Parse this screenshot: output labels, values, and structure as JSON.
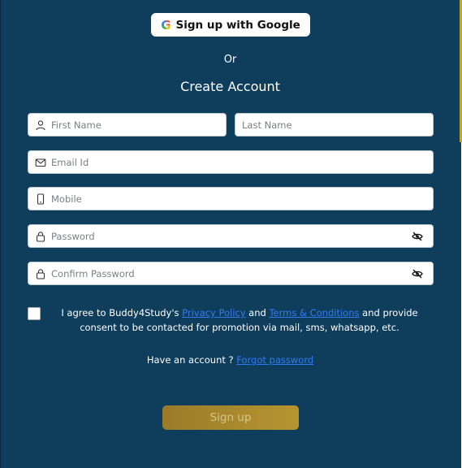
{
  "google": {
    "label": "Sign up with Google"
  },
  "divider": {
    "or": "Or"
  },
  "form": {
    "title": "Create Account",
    "first_name": {
      "placeholder": "First Name",
      "value": ""
    },
    "last_name": {
      "placeholder": "Last Name",
      "value": ""
    },
    "email": {
      "placeholder": "Email Id",
      "value": ""
    },
    "mobile": {
      "placeholder": "Mobile",
      "value": ""
    },
    "password": {
      "placeholder": "Password",
      "value": ""
    },
    "confirm_password": {
      "placeholder": "Confirm Password",
      "value": ""
    }
  },
  "consent": {
    "prefix": "I agree to Buddy4Study's ",
    "privacy_link": "Privacy Policy",
    "and": " and ",
    "terms_link": "Terms & Conditions",
    "suffix": " and provide consent to be contacted for promotion via mail, sms, whatsapp, etc.",
    "checked": false
  },
  "account": {
    "text": "Have an account ? ",
    "link": "Forgot password"
  },
  "submit": {
    "label": "Sign up"
  },
  "colors": {
    "panel": "#0f3d5c",
    "accent": "#c9a227",
    "link": "#2f7cf6"
  }
}
